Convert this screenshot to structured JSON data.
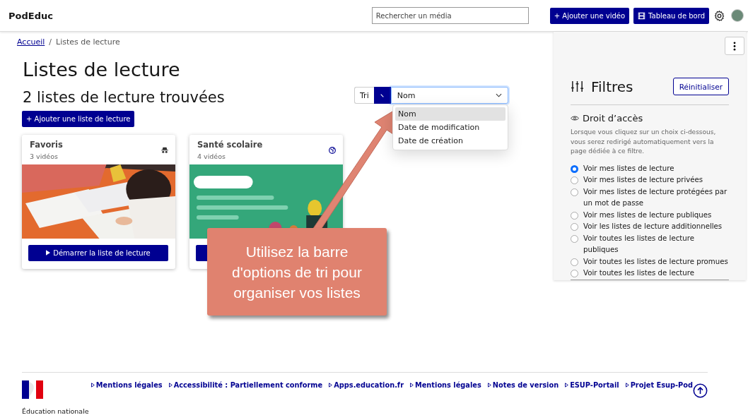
{
  "header": {
    "logo": "PodEduc",
    "search_placeholder": "Rechercher un média",
    "add_video": "+ Ajouter une vidéo",
    "dashboard": "Tableau de bord"
  },
  "breadcrumb_separator": "/",
  "breadcrumb": [
    {
      "label": "Accueil",
      "link": true
    },
    {
      "label": "Listes de lecture",
      "link": false
    }
  ],
  "title": "Listes de lecture",
  "count": "2 listes de lecture trouvées",
  "add_playlist": "+ Ajouter une liste de lecture",
  "sort": {
    "label": "Tri",
    "value": "Nom",
    "expanded": true,
    "options": [
      {
        "label": "Nom",
        "selected": true
      },
      {
        "label": "Date de modification",
        "selected": false
      },
      {
        "label": "Date de création",
        "selected": false
      }
    ]
  },
  "cards": [
    {
      "title": "Favoris",
      "count": "3 vidéos",
      "kind": "private",
      "start_label": "Démarrer la liste de lecture"
    },
    {
      "title": "Santé scolaire",
      "count": "4 vidéos",
      "kind": "public"
    }
  ],
  "filters": {
    "title": "Filtres",
    "reset": "Réinitialiser",
    "section": "Droit d’accès",
    "description": "Lorsque vous cliquez sur un choix ci-dessous, vous serez redirigé automatiquement vers la page dédiée à ce filtre.",
    "options": [
      {
        "label": "Voir mes listes de lecture",
        "selected": true
      },
      {
        "label": "Voir mes listes de lecture privées",
        "selected": false
      },
      {
        "label": "Voir mes listes de lecture protégées par un mot de passe",
        "selected": false
      },
      {
        "label": "Voir mes listes de lecture publiques",
        "selected": false
      },
      {
        "label": "Voir les listes de lecture additionnelles",
        "selected": false
      },
      {
        "label": "Voir toutes les listes de lecture publiques",
        "selected": false
      },
      {
        "label": "Voir toutes les listes de lecture promues",
        "selected": false
      },
      {
        "label": "Voir toutes les listes de lecture",
        "selected": false
      }
    ]
  },
  "footer": {
    "links": [
      "Mentions légales",
      "Accessibilité : Partiellement conforme",
      "Apps.education.fr",
      "Mentions légales",
      "Notes de version",
      "ESUP-Portail",
      "Projet Esup-Pod"
    ],
    "ministry": "Éducation nationale"
  },
  "callout": "Utilisez la barre d'options de tri pour organiser vos listes"
}
